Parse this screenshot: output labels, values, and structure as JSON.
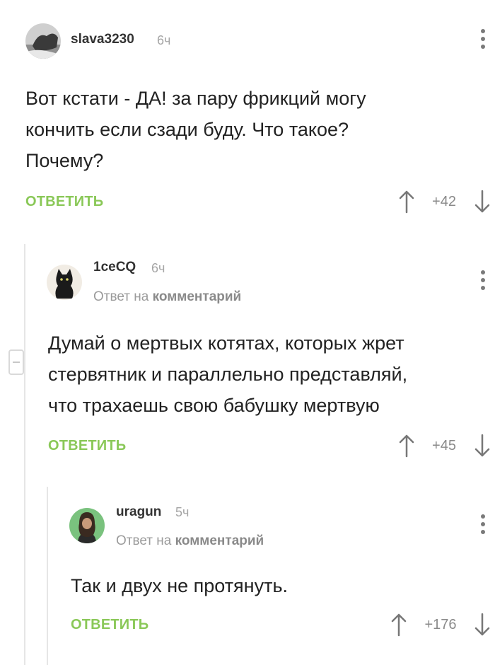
{
  "comments": [
    {
      "username": "slava3230",
      "time": "6ч",
      "text": "Вот кстати - ДА! за пару фрикций могу\nкончить если сзади буду. Что такое?\nПочему?",
      "reply_label": "ОТВЕТИТЬ",
      "rating": "+42",
      "avatar": "avatar-cat-photo"
    },
    {
      "username": "1ceCQ",
      "time": "6ч",
      "reply_to_prefix": "Ответ на",
      "reply_to_link": "комментарий",
      "text": "Думай о мертвых котятах, которых жрет\nстервятник и параллельно представляй,\nчто трахаешь свою бабушку мертвую",
      "reply_label": "ОТВЕТИТЬ",
      "rating": "+45",
      "avatar": "avatar-black-kitten"
    },
    {
      "username": "uragun",
      "time": "5ч",
      "reply_to_prefix": "Ответ на",
      "reply_to_link": "комментарий",
      "text": "Так и двух не протянуть.",
      "reply_label": "ОТВЕТИТЬ",
      "rating": "+176",
      "avatar": "avatar-bearded-man"
    }
  ],
  "icons": {
    "more": "more-vertical-icon",
    "up": "arrow-up-icon",
    "down": "arrow-down-icon",
    "collapse": "minus-icon"
  },
  "colors": {
    "reply": "#8ac858",
    "text": "#222222",
    "muted": "#a5a5a5",
    "thread_line": "#e6e6e6"
  }
}
